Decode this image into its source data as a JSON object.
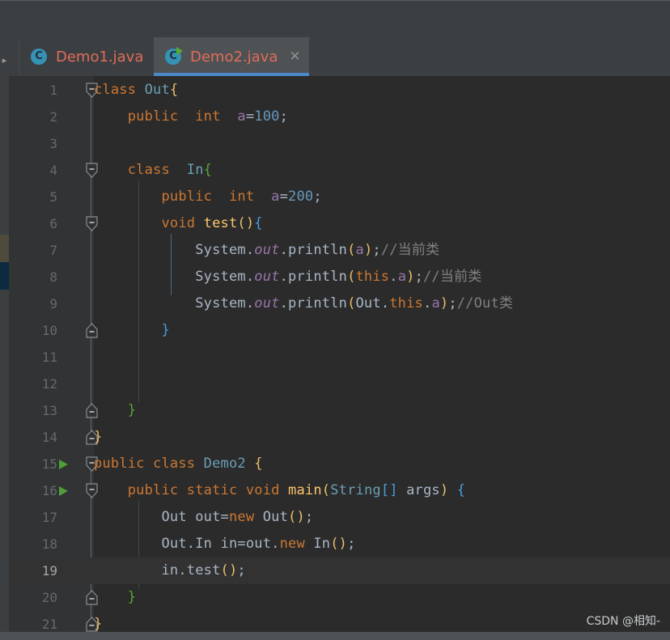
{
  "window": {
    "toolbar_empty": "",
    "tool_strip_arrow": "▸"
  },
  "tabs": [
    {
      "label": "Demo1.java",
      "icon": "java-class-icon",
      "icon_letter": "C",
      "active": false,
      "has_run_badge": false,
      "close_glyph": "✕"
    },
    {
      "label": "Demo2.java",
      "icon": "java-runnable-class-icon",
      "icon_letter": "C",
      "active": true,
      "has_run_badge": true,
      "close_glyph": "✕"
    }
  ],
  "editor": {
    "current_line": 19,
    "lines": [
      {
        "n": "1",
        "run_marker": false,
        "fold": "start",
        "tokens": [
          {
            "t": "class ",
            "c": "kw"
          },
          {
            "t": "Out",
            "c": "type"
          },
          {
            "t": "{",
            "c": "p1"
          }
        ]
      },
      {
        "n": "2",
        "run_marker": false,
        "fold": null,
        "tokens": [
          {
            "t": "    public  ",
            "c": "kw"
          },
          {
            "t": "int  ",
            "c": "kw"
          },
          {
            "t": "a",
            "c": "field"
          },
          {
            "t": "=",
            "c": "punct"
          },
          {
            "t": "100",
            "c": "num"
          },
          {
            "t": ";",
            "c": "punct"
          }
        ]
      },
      {
        "n": "3",
        "run_marker": false,
        "fold": null,
        "tokens": []
      },
      {
        "n": "4",
        "run_marker": false,
        "fold": "start",
        "tokens": [
          {
            "t": "    class  ",
            "c": "kw"
          },
          {
            "t": "In",
            "c": "type"
          },
          {
            "t": "{",
            "c": "p3"
          }
        ]
      },
      {
        "n": "5",
        "run_marker": false,
        "fold": null,
        "tokens": [
          {
            "t": "        public  ",
            "c": "kw"
          },
          {
            "t": "int  ",
            "c": "kw"
          },
          {
            "t": "a",
            "c": "field"
          },
          {
            "t": "=",
            "c": "punct"
          },
          {
            "t": "200",
            "c": "num"
          },
          {
            "t": ";",
            "c": "punct"
          }
        ]
      },
      {
        "n": "6",
        "run_marker": false,
        "fold": "start",
        "tokens": [
          {
            "t": "        void ",
            "c": "kw"
          },
          {
            "t": "test",
            "c": "meth"
          },
          {
            "t": "()",
            "c": "p1"
          },
          {
            "t": "{",
            "c": "p2"
          }
        ]
      },
      {
        "n": "7",
        "run_marker": false,
        "fold": null,
        "tokens": [
          {
            "t": "            System",
            "c": "ident"
          },
          {
            "t": ".",
            "c": "punct"
          },
          {
            "t": "out",
            "c": "fieldi"
          },
          {
            "t": ".println",
            "c": "ident"
          },
          {
            "t": "(",
            "c": "p1"
          },
          {
            "t": "a",
            "c": "field"
          },
          {
            "t": ")",
            "c": "p1"
          },
          {
            "t": ";",
            "c": "punct"
          },
          {
            "t": "//当前类",
            "c": "cmt"
          }
        ]
      },
      {
        "n": "8",
        "run_marker": false,
        "fold": null,
        "tokens": [
          {
            "t": "            System",
            "c": "ident"
          },
          {
            "t": ".",
            "c": "punct"
          },
          {
            "t": "out",
            "c": "fieldi"
          },
          {
            "t": ".println",
            "c": "ident"
          },
          {
            "t": "(",
            "c": "p1"
          },
          {
            "t": "this",
            "c": "kw"
          },
          {
            "t": ".",
            "c": "punct"
          },
          {
            "t": "a",
            "c": "field"
          },
          {
            "t": ")",
            "c": "p1"
          },
          {
            "t": ";",
            "c": "punct"
          },
          {
            "t": "//当前类",
            "c": "cmt"
          }
        ]
      },
      {
        "n": "9",
        "run_marker": false,
        "fold": null,
        "tokens": [
          {
            "t": "            System",
            "c": "ident"
          },
          {
            "t": ".",
            "c": "punct"
          },
          {
            "t": "out",
            "c": "fieldi"
          },
          {
            "t": ".println",
            "c": "ident"
          },
          {
            "t": "(",
            "c": "p1"
          },
          {
            "t": "Out",
            "c": "ident"
          },
          {
            "t": ".",
            "c": "punct"
          },
          {
            "t": "this",
            "c": "kw"
          },
          {
            "t": ".",
            "c": "punct"
          },
          {
            "t": "a",
            "c": "field"
          },
          {
            "t": ")",
            "c": "p1"
          },
          {
            "t": ";",
            "c": "punct"
          },
          {
            "t": "//Out类",
            "c": "cmt"
          }
        ]
      },
      {
        "n": "10",
        "run_marker": false,
        "fold": "end",
        "tokens": [
          {
            "t": "        ",
            "c": "punct"
          },
          {
            "t": "}",
            "c": "p2"
          }
        ]
      },
      {
        "n": "11",
        "run_marker": false,
        "fold": null,
        "tokens": []
      },
      {
        "n": "12",
        "run_marker": false,
        "fold": null,
        "tokens": []
      },
      {
        "n": "13",
        "run_marker": false,
        "fold": "end",
        "tokens": [
          {
            "t": "    ",
            "c": "punct"
          },
          {
            "t": "}",
            "c": "p3"
          }
        ]
      },
      {
        "n": "14",
        "run_marker": false,
        "fold": "end-top",
        "tokens": [
          {
            "t": "}",
            "c": "p1"
          }
        ]
      },
      {
        "n": "15",
        "run_marker": true,
        "fold": "start",
        "tokens": [
          {
            "t": "public class ",
            "c": "kw"
          },
          {
            "t": "Demo2 ",
            "c": "type"
          },
          {
            "t": "{",
            "c": "p1"
          }
        ]
      },
      {
        "n": "16",
        "run_marker": true,
        "fold": "start",
        "tokens": [
          {
            "t": "    public static void ",
            "c": "kw"
          },
          {
            "t": "main",
            "c": "meth"
          },
          {
            "t": "(",
            "c": "p1"
          },
          {
            "t": "String",
            "c": "type"
          },
          {
            "t": "[]",
            "c": "p2"
          },
          {
            "t": " args",
            "c": "ident"
          },
          {
            "t": ")",
            "c": "p1"
          },
          {
            "t": " ",
            "c": "punct"
          },
          {
            "t": "{",
            "c": "p2"
          }
        ]
      },
      {
        "n": "17",
        "run_marker": false,
        "fold": null,
        "tokens": [
          {
            "t": "        Out out",
            "c": "ident"
          },
          {
            "t": "=",
            "c": "punct"
          },
          {
            "t": "new ",
            "c": "kw"
          },
          {
            "t": "Out",
            "c": "ident"
          },
          {
            "t": "()",
            "c": "p1"
          },
          {
            "t": ";",
            "c": "punct"
          }
        ]
      },
      {
        "n": "18",
        "run_marker": false,
        "fold": null,
        "tokens": [
          {
            "t": "        Out.In in",
            "c": "ident"
          },
          {
            "t": "=",
            "c": "punct"
          },
          {
            "t": "out",
            "c": "ident"
          },
          {
            "t": ".",
            "c": "punct"
          },
          {
            "t": "new ",
            "c": "kw"
          },
          {
            "t": "In",
            "c": "ident"
          },
          {
            "t": "()",
            "c": "p1"
          },
          {
            "t": ";",
            "c": "punct"
          }
        ]
      },
      {
        "n": "19",
        "run_marker": false,
        "fold": null,
        "tokens": [
          {
            "t": "        in.test",
            "c": "ident"
          },
          {
            "t": "()",
            "c": "p1"
          },
          {
            "t": ";",
            "c": "punct"
          }
        ]
      },
      {
        "n": "20",
        "run_marker": false,
        "fold": "end",
        "tokens": [
          {
            "t": "    ",
            "c": "punct"
          },
          {
            "t": "}",
            "c": "p3"
          }
        ]
      },
      {
        "n": "21",
        "run_marker": false,
        "fold": "end-top",
        "tokens": [
          {
            "t": "}",
            "c": "p1"
          }
        ]
      }
    ]
  },
  "watermark": {
    "text": "CSDN @相知-"
  },
  "colors": {
    "editor_bg": "#2b2b2b",
    "gutter_bg": "#313335",
    "chrome_bg": "#3c3f41",
    "active_tab_bg": "#4e5254",
    "tab_underline": "#4a88c7",
    "tab_title": "#e06c5a",
    "keyword": "#cc7832",
    "type": "#6a9fb5",
    "number": "#6897bb",
    "field": "#9876aa",
    "method": "#ffc66d",
    "comment": "#808080",
    "identifier": "#a9b7c6",
    "run_arrow": "#4f9e38",
    "current_line_bg": "#323232",
    "marker_olive": "#4e4a3c",
    "marker_navy": "#0d2a41"
  }
}
